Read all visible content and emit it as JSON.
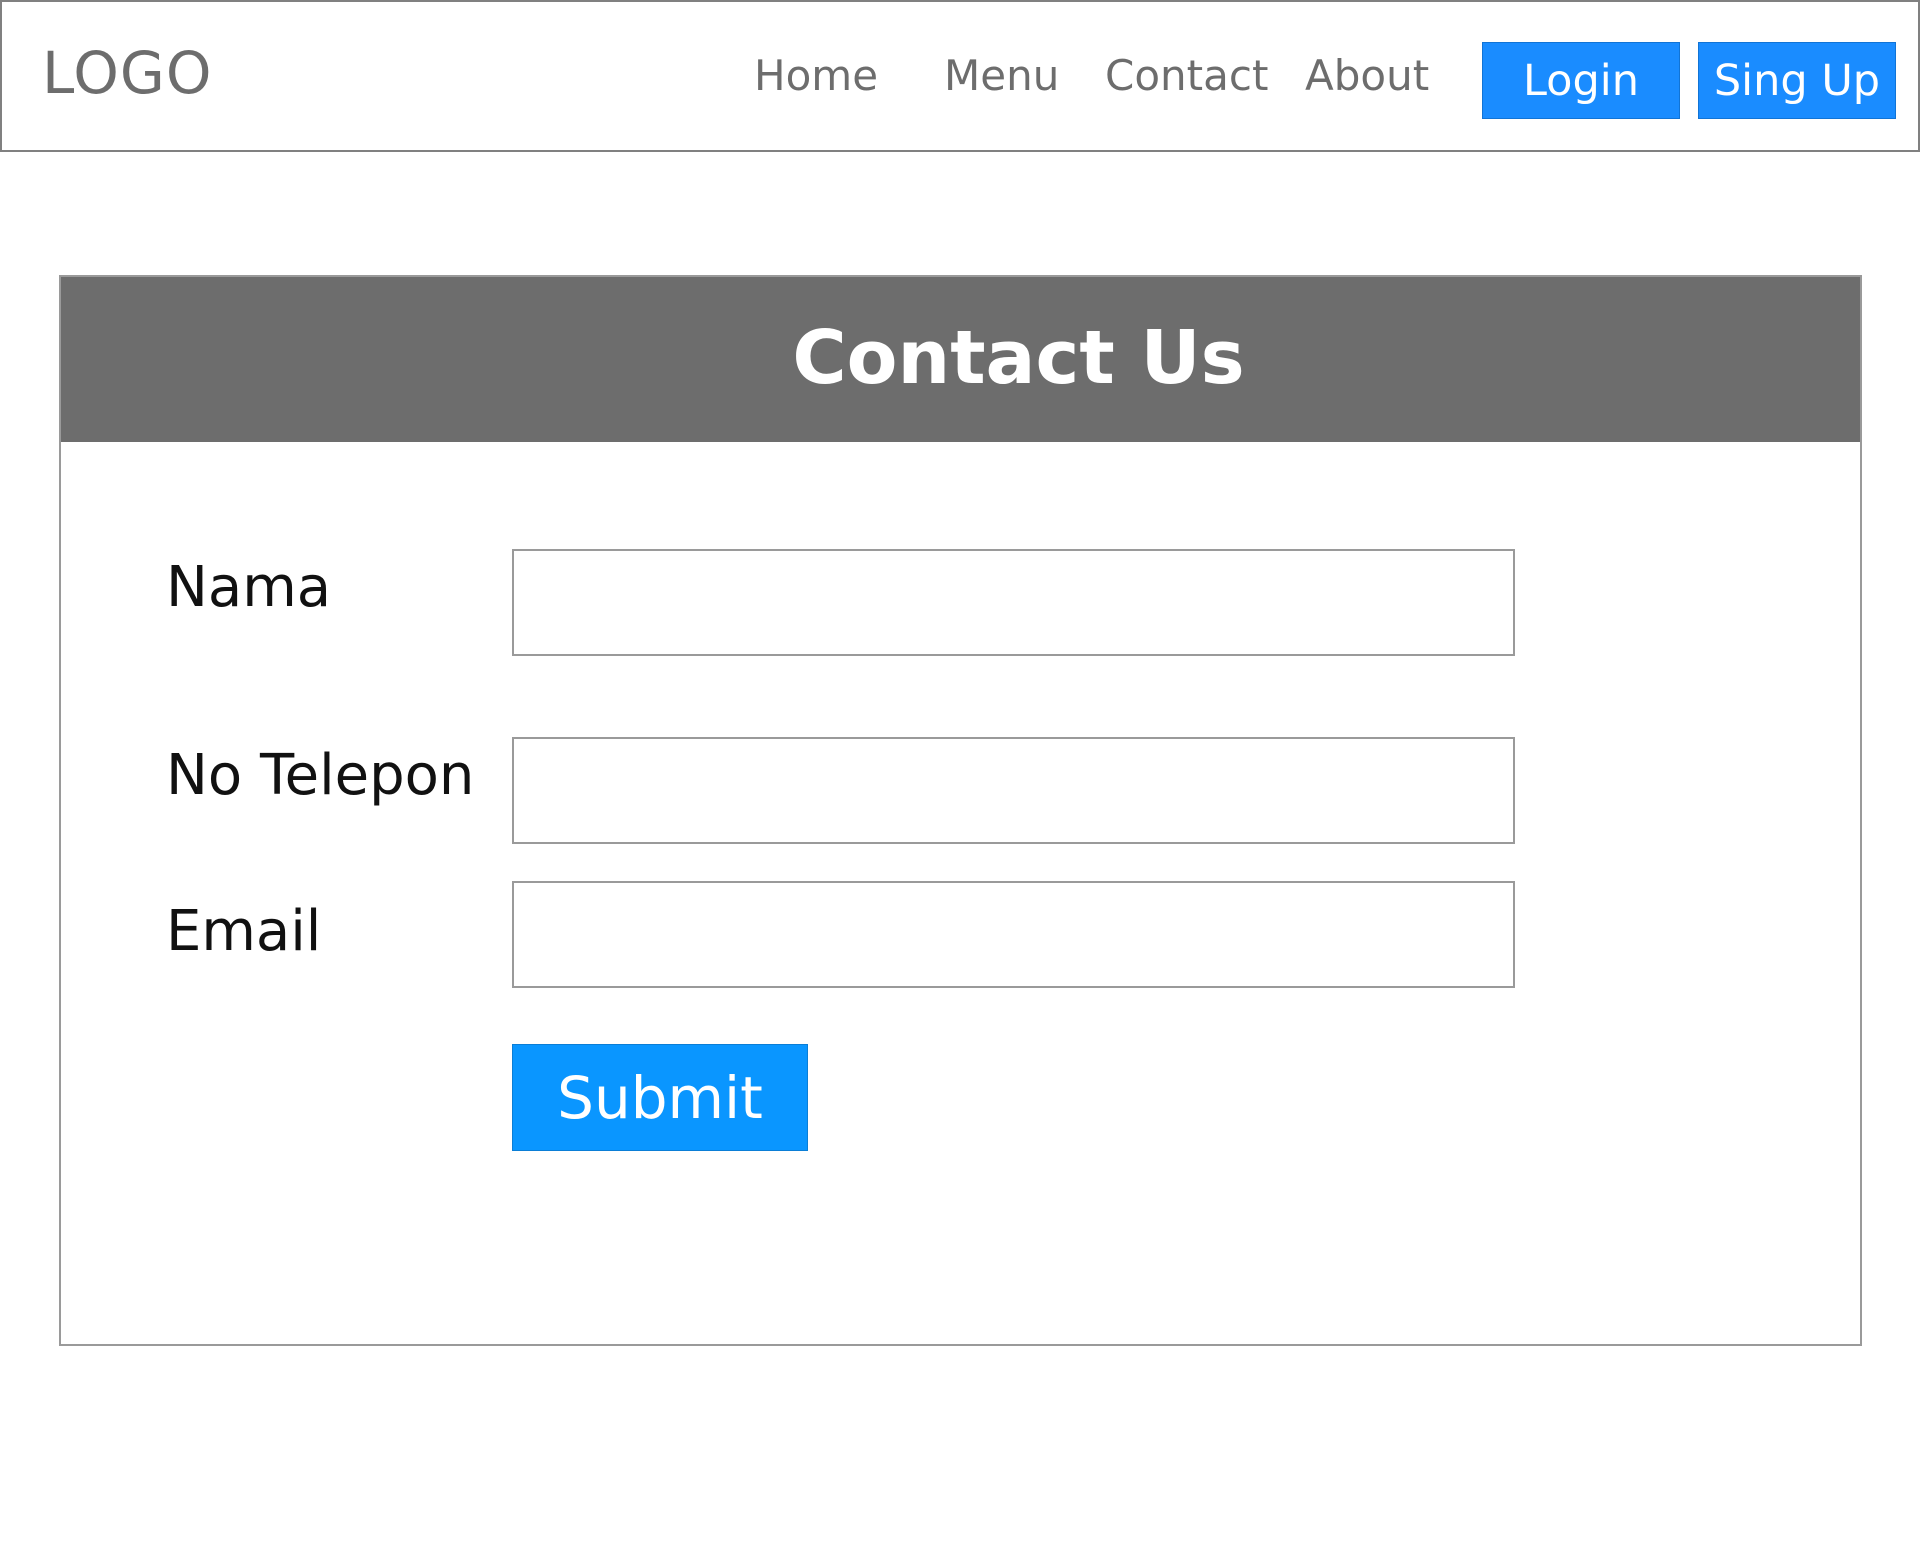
{
  "navbar": {
    "logo": "LOGO",
    "links": [
      "Home",
      "Menu",
      "Contact",
      "About"
    ],
    "login_label": "Login",
    "signup_label": "Sing Up"
  },
  "contact_form": {
    "title": "Contact Us",
    "fields": [
      {
        "label": "Nama",
        "value": ""
      },
      {
        "label": "No Telepon",
        "value": ""
      },
      {
        "label": "Email",
        "value": ""
      }
    ],
    "submit_label": "Submit"
  },
  "colors": {
    "primary_button": "#1a8cff",
    "submit_button": "#0a96ff",
    "header_bar": "#6d6d6d",
    "nav_text": "#6d6d6d"
  }
}
